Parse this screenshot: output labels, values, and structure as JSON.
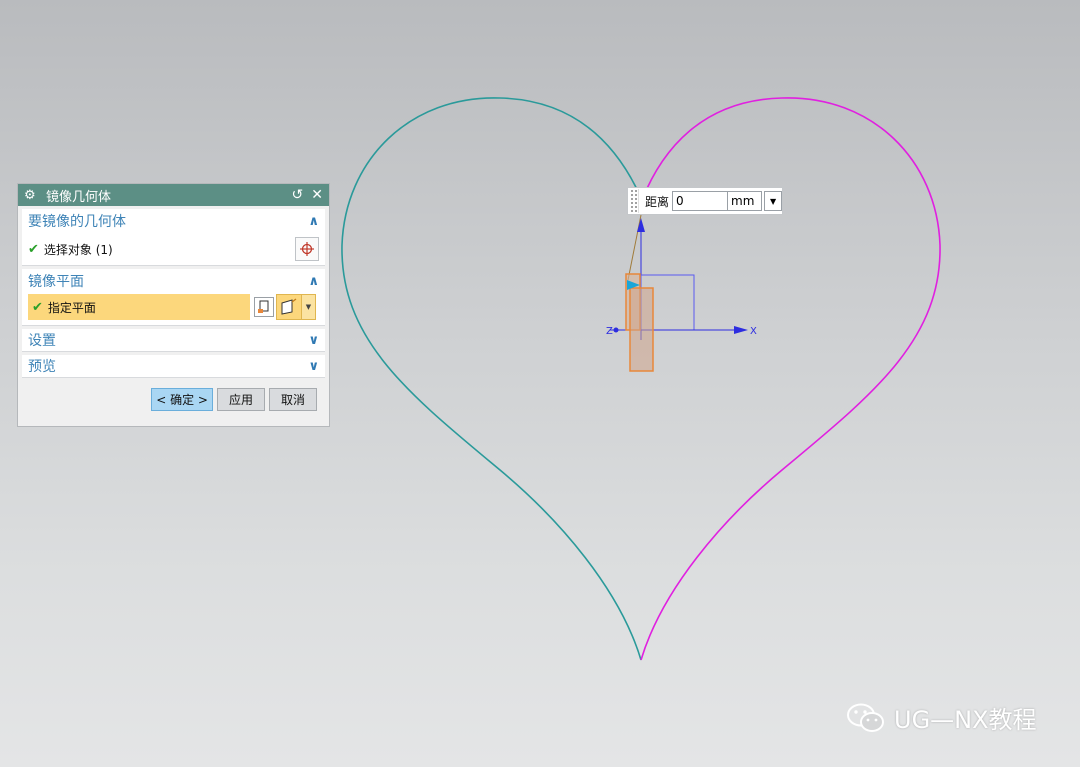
{
  "dialog": {
    "title": "镜像几何体",
    "icons": {
      "settings": "gear-icon",
      "reset": "reset-icon",
      "close": "close-icon"
    },
    "geometry_section": {
      "title": "要镜像的几何体",
      "select_label": "选择对象 (1)"
    },
    "plane_section": {
      "title": "镜像平面",
      "specify_label": "指定平面"
    },
    "settings_section": {
      "title": "设置"
    },
    "preview_section": {
      "title": "预览"
    },
    "buttons": {
      "ok": "< 确定 >",
      "apply": "应用",
      "cancel": "取消"
    }
  },
  "distance_box": {
    "label": "距离",
    "value": "0",
    "unit": "mm"
  },
  "viewport": {
    "axis_x_label": "X",
    "axis_z_label": "Z",
    "colors": {
      "original_curve": "#2a9a9a",
      "mirror_curve": "#e020e0",
      "axis": "#2d2de0",
      "plane": "#e8873a"
    }
  },
  "watermark": {
    "text": "UG—NX教程"
  }
}
